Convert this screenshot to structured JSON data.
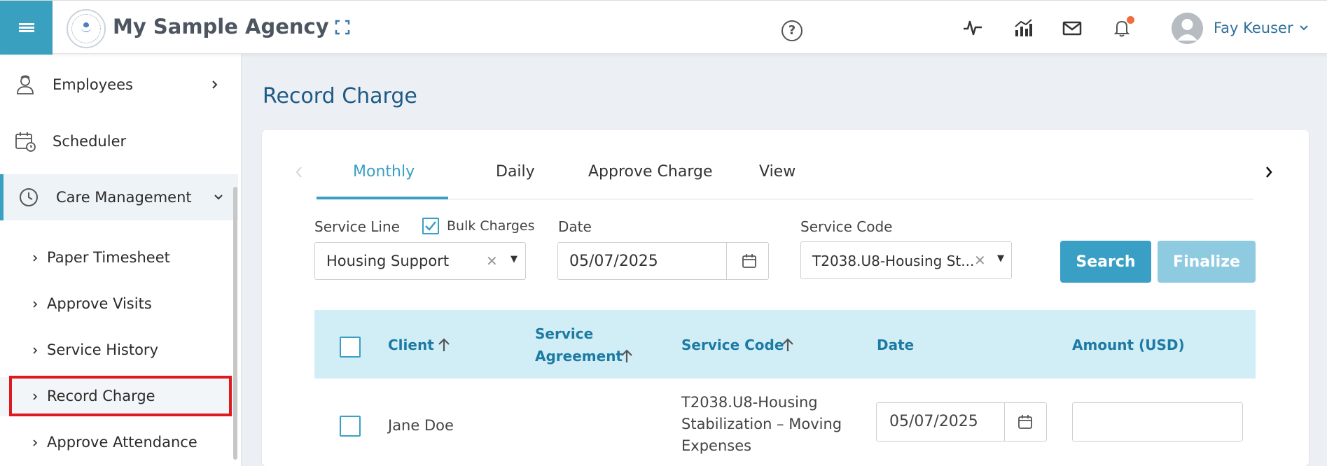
{
  "header": {
    "agency_name": "My Sample Agency",
    "help_symbol": "?",
    "user_name": "Fay Keuser"
  },
  "sidebar": {
    "items": [
      {
        "label": "Employees",
        "icon": "employee-icon"
      },
      {
        "label": "Scheduler",
        "icon": "calendar-clock-icon"
      },
      {
        "label": "Care Management",
        "icon": "clock-icon"
      }
    ],
    "sub_items": [
      "Paper Timesheet",
      "Approve Visits",
      "Service History",
      "Record Charge",
      "Approve Attendance"
    ],
    "selected_sub_item": "Record Charge"
  },
  "page": {
    "title": "Record Charge"
  },
  "tabs": [
    "Monthly",
    "Daily",
    "Approve Charge",
    "View"
  ],
  "active_tab": "Monthly",
  "form": {
    "service_line_label": "Service Line",
    "bulk_charges_label": "Bulk Charges",
    "bulk_charges_checked": true,
    "service_line_value": "Housing Support",
    "date_label": "Date",
    "date_value": "05/07/2025",
    "service_code_label": "Service Code",
    "service_code_value": "T2038.U8-Housing St...",
    "search_button": "Search",
    "finalize_button": "Finalize"
  },
  "table": {
    "columns": [
      "Client",
      "Service",
      "Agreement",
      "Service Code",
      "Date",
      "Amount (USD)"
    ],
    "rows": [
      {
        "client": "Jane Doe",
        "service_code_lines": [
          "T2038.U8-Housing",
          "Stabilization – Moving",
          "Expenses"
        ],
        "date": "05/07/2025",
        "amount": ""
      }
    ]
  },
  "colors": {
    "accent": "#3a9fc4",
    "header_bg": "#d1eef7",
    "title": "#1e5a86",
    "highlight": "#e0191e"
  }
}
